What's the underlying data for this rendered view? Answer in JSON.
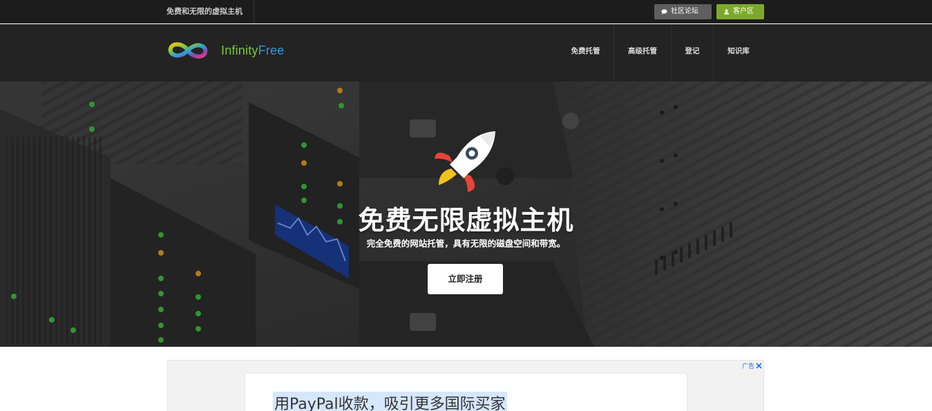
{
  "topbar": {
    "tagline": "免费和无限的虚拟主机",
    "forum_button": {
      "label": "社区论坛",
      "icon": "chat-bubble-icon"
    },
    "client_button": {
      "label": "客户区",
      "icon": "user-icon"
    }
  },
  "header": {
    "logo": {
      "word1": "Infinity",
      "word2": "Free",
      "icon": "infinity-logo-icon"
    },
    "nav": [
      {
        "label": "免费托管"
      },
      {
        "label": "高级托管"
      },
      {
        "label": "登记"
      },
      {
        "label": "知识库"
      }
    ]
  },
  "hero": {
    "icon": "rocket-icon",
    "title": "免费无限虚拟主机",
    "subtitle": "完全免费的网站托管，具有无限的磁盘空间和带宽。",
    "cta_label": "立即注册"
  },
  "ad": {
    "badge_label": "广告",
    "headline": "用PayPal收款，吸引更多国际买家"
  },
  "colors": {
    "topbar_bg": "#1c1c1c",
    "header_bg": "#232323",
    "forum_btn": "#5e5e5e",
    "client_btn": "#7ca92b",
    "logo_green": "#7cc63f",
    "logo_blue": "#2b9be0"
  }
}
